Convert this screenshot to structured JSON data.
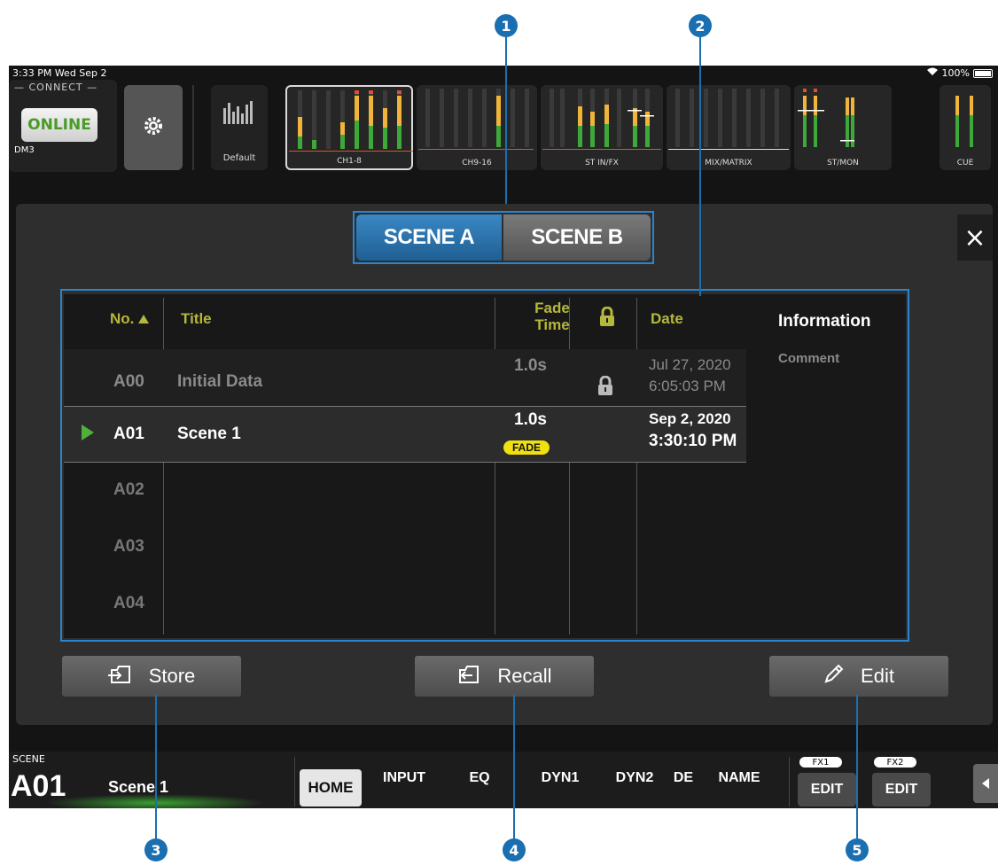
{
  "status": {
    "time": "3:33 PM  Wed Sep 2",
    "battery": "100%"
  },
  "connect": {
    "label": "— CONNECT —",
    "online": "ONLINE",
    "model": "DM3"
  },
  "meters": {
    "default_label": "Default",
    "groups": [
      "CH1-8",
      "CH9-16",
      "ST IN/FX",
      "MIX/MATRIX",
      "ST/MON",
      "CUE"
    ]
  },
  "scene_tabs": {
    "a": "SCENE A",
    "b": "SCENE B",
    "selected": "SCENE A"
  },
  "close_icon": "×",
  "table": {
    "headers": {
      "no": "No.",
      "title": "Title",
      "fade1": "Fade",
      "fade2": "Time",
      "date": "Date"
    },
    "info_title": "Information",
    "info_comment": "Comment",
    "rows": [
      {
        "no": "A00",
        "title": "Initial Data",
        "fade": "1.0s",
        "locked": true,
        "date": "Jul 27, 2020",
        "time": "6:05:03 PM"
      },
      {
        "no": "A01",
        "title": "Scene 1",
        "fade": "1.0s",
        "fade_badge": "FADE",
        "locked": false,
        "date": "Sep 2, 2020",
        "time": "3:30:10 PM",
        "current": true
      },
      {
        "no": "A02",
        "title": "",
        "fade": "",
        "date": "",
        "time": ""
      },
      {
        "no": "A03",
        "title": "",
        "fade": "",
        "date": "",
        "time": ""
      },
      {
        "no": "A04",
        "title": "",
        "fade": "",
        "date": "",
        "time": ""
      }
    ]
  },
  "actions": {
    "store": "Store",
    "recall": "Recall",
    "edit": "Edit"
  },
  "bottom": {
    "scene_caption": "SCENE",
    "scene_number": "A01",
    "scene_title": "Scene 1",
    "home": "HOME",
    "tabs": [
      "INPUT",
      "EQ",
      "DYN1",
      "DYN2",
      "DE",
      "NAME"
    ],
    "fx1": "FX1",
    "fx2": "FX2",
    "fx_edit": "EDIT"
  },
  "callouts": [
    "1",
    "2",
    "3",
    "4",
    "5"
  ],
  "colors": {
    "accent_blue": "#2a84d0",
    "meter_green": "#3fa83a",
    "meter_yellow": "#f0b43a",
    "header_olive": "#b5b83a"
  }
}
